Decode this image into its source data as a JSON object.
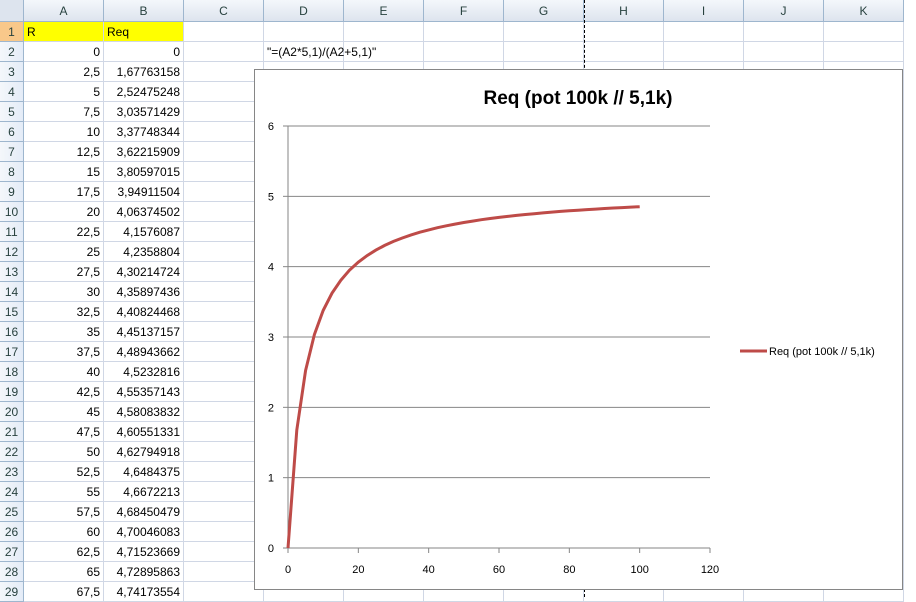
{
  "columns": [
    "A",
    "B",
    "C",
    "D",
    "E",
    "F",
    "G",
    "H",
    "I",
    "J",
    "K"
  ],
  "header_row": {
    "A": "R",
    "B": "Req"
  },
  "formula_note": "\"=(A2*5,1)/(A2+5,1)\"",
  "rows": [
    [
      "0",
      "0"
    ],
    [
      "2,5",
      "1,67763158"
    ],
    [
      "5",
      "2,52475248"
    ],
    [
      "7,5",
      "3,03571429"
    ],
    [
      "10",
      "3,37748344"
    ],
    [
      "12,5",
      "3,62215909"
    ],
    [
      "15",
      "3,80597015"
    ],
    [
      "17,5",
      "3,94911504"
    ],
    [
      "20",
      "4,06374502"
    ],
    [
      "22,5",
      "4,1576087"
    ],
    [
      "25",
      "4,2358804"
    ],
    [
      "27,5",
      "4,30214724"
    ],
    [
      "30",
      "4,35897436"
    ],
    [
      "32,5",
      "4,40824468"
    ],
    [
      "35",
      "4,45137157"
    ],
    [
      "37,5",
      "4,48943662"
    ],
    [
      "40",
      "4,5232816"
    ],
    [
      "42,5",
      "4,55357143"
    ],
    [
      "45",
      "4,58083832"
    ],
    [
      "47,5",
      "4,60551331"
    ],
    [
      "50",
      "4,62794918"
    ],
    [
      "52,5",
      "4,6484375"
    ],
    [
      "55",
      "4,6672213"
    ],
    [
      "57,5",
      "4,68450479"
    ],
    [
      "60",
      "4,70046083"
    ],
    [
      "62,5",
      "4,71523669"
    ],
    [
      "65",
      "4,72895863"
    ],
    [
      "67,5",
      "4,74173554"
    ]
  ],
  "chart_data": {
    "type": "line",
    "title": "Req (pot 100k // 5,1k)",
    "xlabel": "",
    "ylabel": "",
    "xlim": [
      0,
      120
    ],
    "ylim": [
      0,
      6
    ],
    "xticks": [
      0,
      20,
      40,
      60,
      80,
      100,
      120
    ],
    "yticks": [
      0,
      1,
      2,
      3,
      4,
      5,
      6
    ],
    "grid": "horizontal",
    "legend": "right",
    "series": [
      {
        "name": "Req (pot 100k // 5,1k)",
        "color": "#be4b48",
        "x": [
          0,
          2.5,
          5,
          7.5,
          10,
          12.5,
          15,
          17.5,
          20,
          22.5,
          25,
          27.5,
          30,
          32.5,
          35,
          37.5,
          40,
          42.5,
          45,
          47.5,
          50,
          52.5,
          55,
          57.5,
          60,
          62.5,
          65,
          67.5,
          70,
          72.5,
          75,
          77.5,
          80,
          82.5,
          85,
          87.5,
          90,
          92.5,
          95,
          97.5,
          100
        ],
        "y": [
          0,
          1.6776,
          2.5248,
          3.0357,
          3.3775,
          3.6222,
          3.806,
          3.9491,
          4.0637,
          4.1576,
          4.2359,
          4.3021,
          4.359,
          4.4082,
          4.4514,
          4.4894,
          4.5233,
          4.5536,
          4.5808,
          4.6055,
          4.6279,
          4.6484,
          4.6672,
          4.6845,
          4.7005,
          4.7152,
          4.729,
          4.7417,
          4.7537,
          4.7648,
          4.7753,
          4.7851,
          4.7944,
          4.8031,
          4.8113,
          4.8191,
          4.8265,
          4.8335,
          4.8402,
          4.8465,
          4.8525
        ]
      }
    ]
  }
}
